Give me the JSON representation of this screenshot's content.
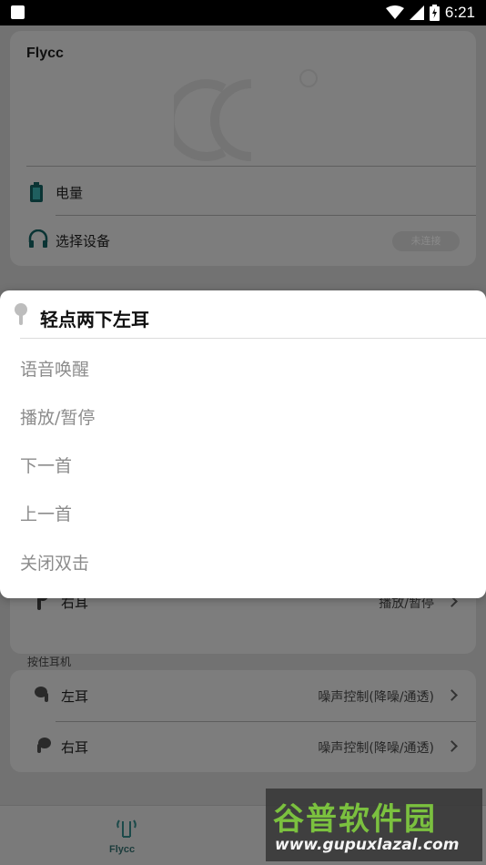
{
  "status_bar": {
    "time": "6:21"
  },
  "app": {
    "title": "Flycc",
    "battery_label": "电量",
    "select_device_label": "选择设备",
    "connect_pill": "未连接",
    "right_ear_label": "右耳",
    "right_ear_value": "播放/暂停",
    "hold_section_label": "按住耳机",
    "hold_left_label": "左耳",
    "hold_left_value": "噪声控制(降噪/通透)",
    "hold_right_label": "右耳",
    "hold_right_value": "噪声控制(降噪/通透)"
  },
  "bottom_nav": {
    "item_label": "Flycc"
  },
  "dialog": {
    "title": "轻点两下左耳",
    "options": [
      "语音唤醒",
      "播放/暂停",
      "下一首",
      "上一首",
      "关闭双击"
    ]
  },
  "watermark": {
    "name": "谷普软件园",
    "url": "www.gupuxlazal.com"
  },
  "colors": {
    "accent": "#2a7a7a",
    "dialog_bg": "#ffffff",
    "option_text": "#8c8c8c"
  }
}
